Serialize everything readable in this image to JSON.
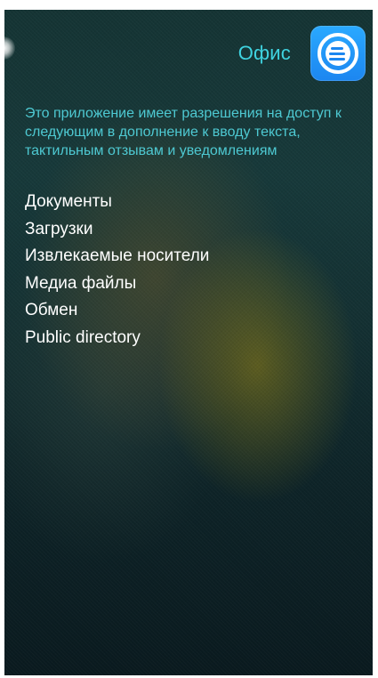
{
  "header": {
    "app_name": "Офис",
    "app_icon": "office-app-icon"
  },
  "description": "Это приложение имеет разрешения на доступ к следующим в дополнение к вводу текста, тактильным отзывам и уведомлениям",
  "permissions": [
    "Документы",
    "Загрузки",
    "Извлекаемые носители",
    "Медиа файлы",
    "Обмен",
    "Public directory"
  ],
  "colors": {
    "accent": "#3fd3e0",
    "description_text": "#4ec9d2",
    "icon_background": "#1c86f0"
  }
}
